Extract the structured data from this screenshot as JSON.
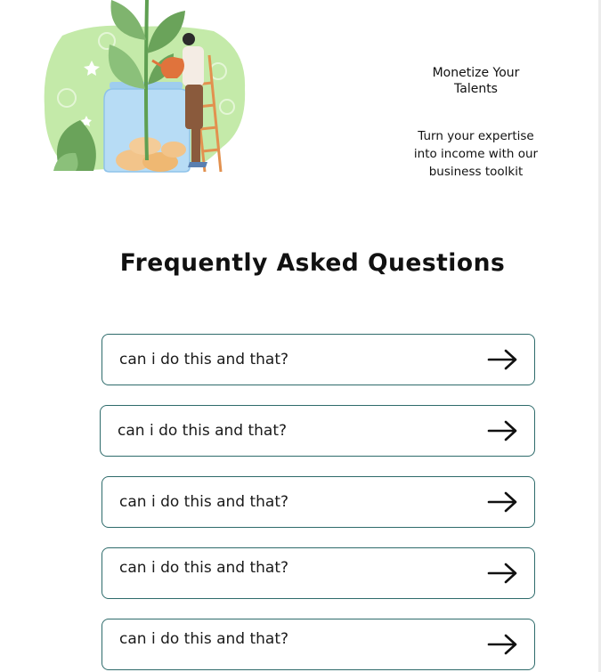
{
  "promo": {
    "title": "Monetize Your Talents",
    "subtitle": "Turn your expertise into income with our business toolkit"
  },
  "faq": {
    "heading": "Frequently Asked Questions",
    "items": [
      {
        "question": "can i do this and that?",
        "icon": "arrow-right-icon"
      },
      {
        "question": "can i do this and that?",
        "icon": "arrow-right-icon"
      },
      {
        "question": "can i do this and that?",
        "icon": "arrow-right-icon"
      },
      {
        "question": "can i do this and that?",
        "icon": "arrow-right-icon"
      },
      {
        "question": "can i do this and that?",
        "icon": "arrow-right-icon"
      }
    ]
  },
  "colors": {
    "card_border": "#2e6b6b",
    "illustration_bg": "#bfe8a4",
    "leaf_green": "#6aa35a",
    "jar_blue": "#b7dcf5",
    "coin_gold": "#f2c48a"
  }
}
